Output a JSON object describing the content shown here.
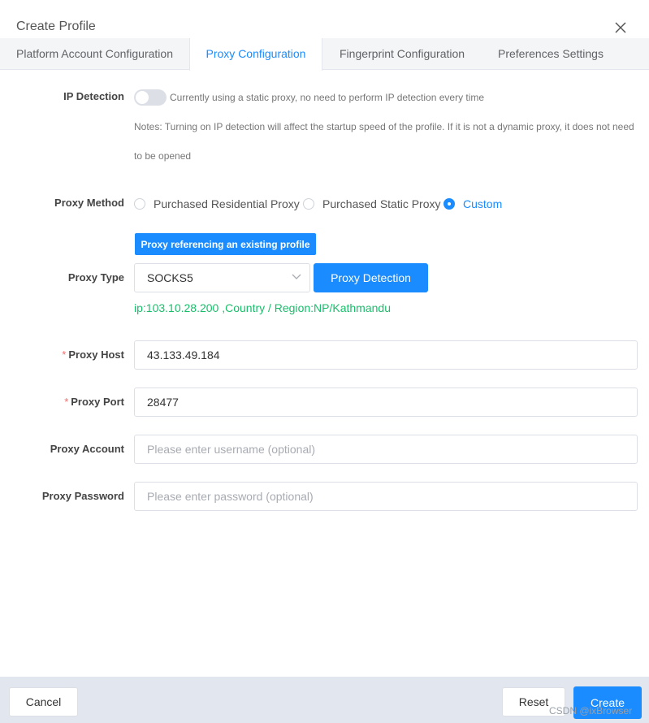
{
  "dialog": {
    "title": "Create Profile",
    "close_icon": "close-icon"
  },
  "tabs": [
    {
      "label": "Platform Account Configuration",
      "active": false
    },
    {
      "label": "Proxy Configuration",
      "active": true
    },
    {
      "label": "Fingerprint Configuration",
      "active": false
    },
    {
      "label": "Preferences Settings",
      "active": false
    }
  ],
  "ip_detection": {
    "label": "IP Detection",
    "enabled": false,
    "status_text": "Currently using a static proxy, no need to perform IP detection every time",
    "notes_line1": "Notes: Turning on IP detection will affect the startup speed of the profile. If it is not a dynamic proxy, it does not need",
    "notes_line2": "to be opened"
  },
  "proxy_method": {
    "label": "Proxy Method",
    "options": [
      {
        "label": "Purchased Residential Proxy",
        "checked": false
      },
      {
        "label": "Purchased Static Proxy",
        "checked": false
      },
      {
        "label": "Custom",
        "checked": true
      }
    ],
    "reference_button": "Proxy referencing an existing profile"
  },
  "proxy_type": {
    "label": "Proxy Type",
    "selected": "SOCKS5",
    "detect_button": "Proxy Detection",
    "detection_result": "ip:103.10.28.200 ,Country / Region:NP/Kathmandu"
  },
  "proxy_host": {
    "required_mark": "*",
    "label": "Proxy Host",
    "value": "43.133.49.184"
  },
  "proxy_port": {
    "required_mark": "*",
    "label": "Proxy Port",
    "value": "28477"
  },
  "proxy_account": {
    "label": "Proxy Account",
    "value": "",
    "placeholder": "Please enter username (optional)"
  },
  "proxy_password": {
    "label": "Proxy Password",
    "value": "",
    "placeholder": "Please enter password (optional)"
  },
  "footer": {
    "cancel_label": "Cancel",
    "reset_label": "Reset",
    "create_label": "Create"
  },
  "watermark": "CSDN @ixBrowser",
  "colors": {
    "primary": "#1a8cff",
    "success": "#19be6b",
    "required": "#f56c6c",
    "footer_bg": "#e2e6ee"
  }
}
